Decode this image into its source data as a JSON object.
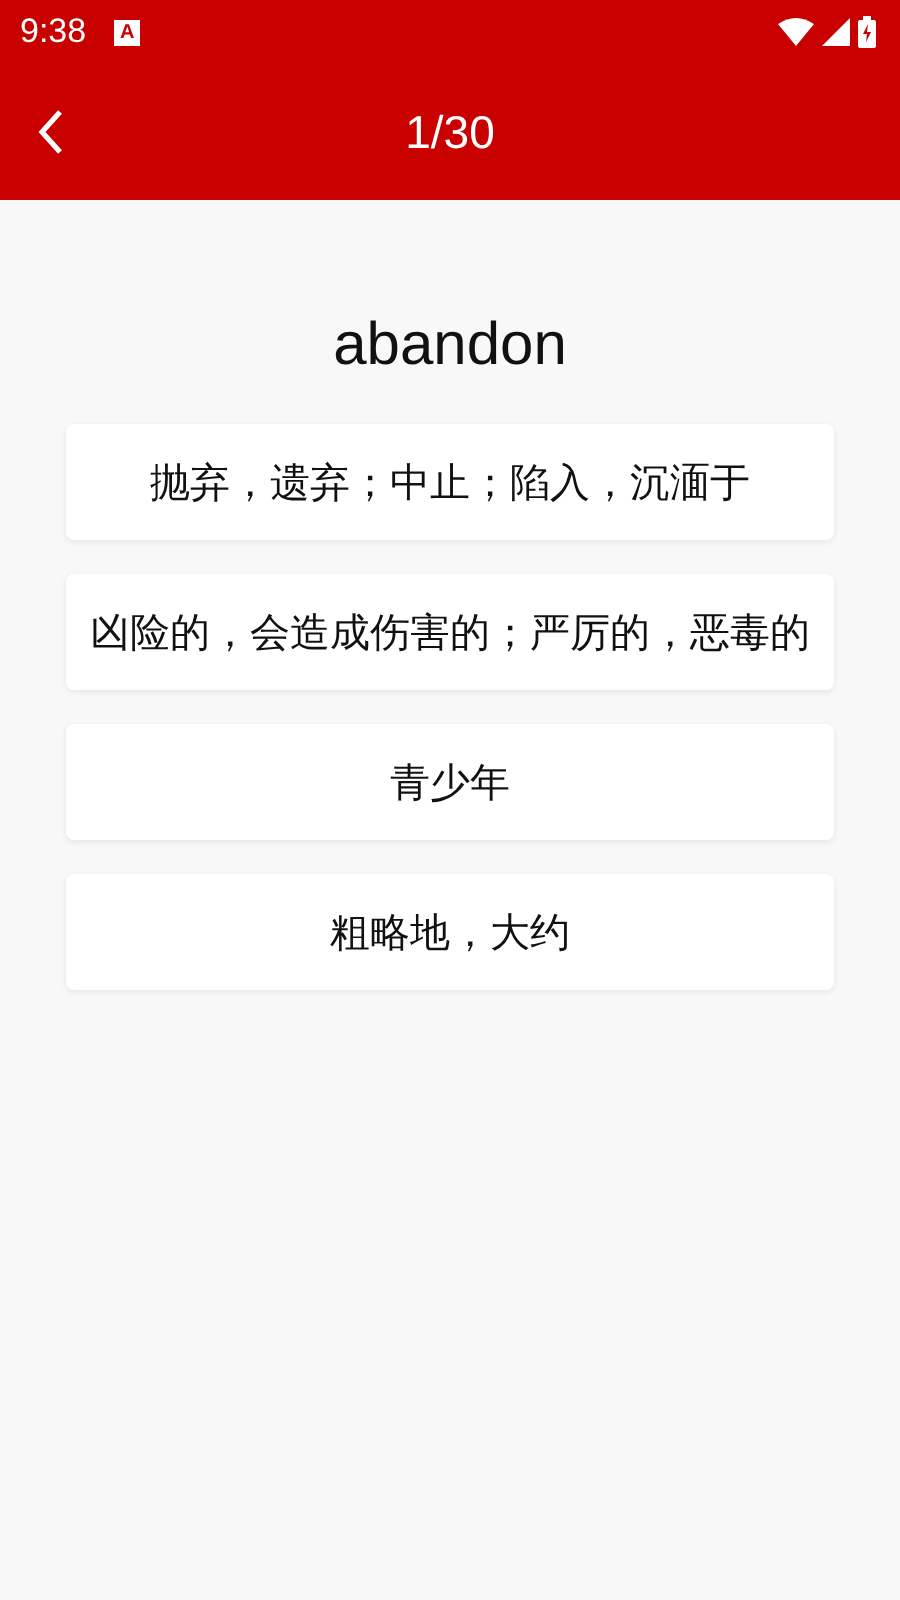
{
  "status_bar": {
    "time": "9:38",
    "notification": "A"
  },
  "app_bar": {
    "title": "1/30"
  },
  "word": "abandon",
  "options": [
    {
      "text": "抛弃，遗弃；中止；陷入，沉湎于"
    },
    {
      "text": "凶险的，会造成伤害的；严厉的，恶毒的"
    },
    {
      "text": "青少年"
    },
    {
      "text": "粗略地，大约"
    }
  ]
}
